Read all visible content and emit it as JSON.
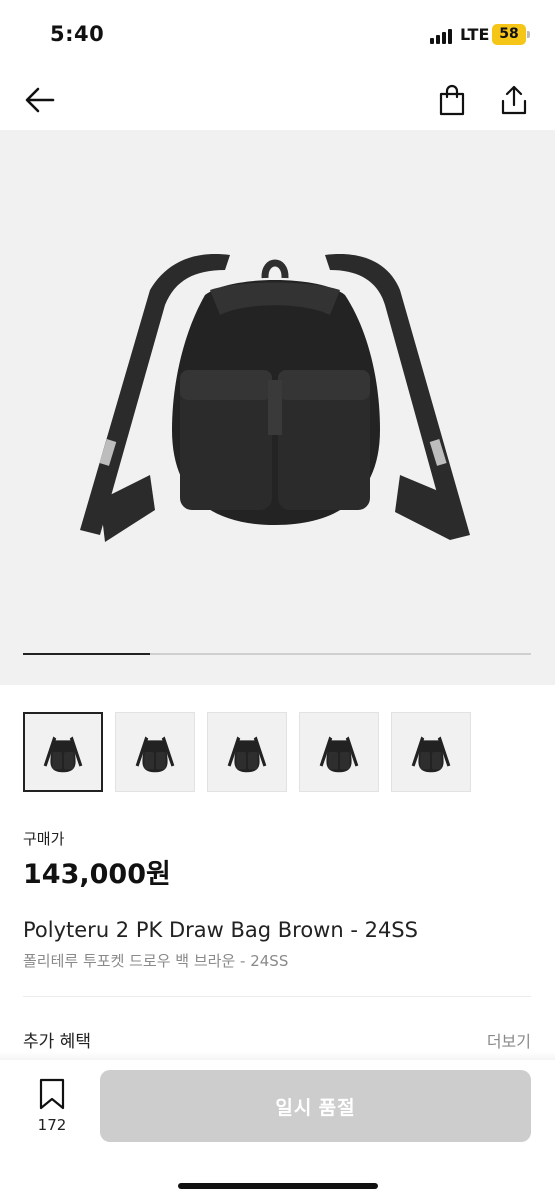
{
  "status_bar": {
    "time": "5:40",
    "network": "LTE",
    "battery": "58"
  },
  "nav": {
    "back_icon": "arrow-left-icon",
    "bag_icon": "shopping-bag-icon",
    "share_icon": "share-icon"
  },
  "hero": {
    "image": "black-drawstring-backpack",
    "gallery_progress": 0.25
  },
  "thumbnails": [
    {
      "name": "front-view",
      "active": true
    },
    {
      "name": "alt-front-view",
      "active": false
    },
    {
      "name": "angled-view",
      "active": false
    },
    {
      "name": "back-view",
      "active": false
    },
    {
      "name": "side-view",
      "active": false
    }
  ],
  "product": {
    "price_label": "구매가",
    "price": "143,000원",
    "name_en": "Polyteru 2 PK Draw Bag Brown - 24SS",
    "name_ko": "폴리테루 투포켓 드로우 백 브라운 - 24SS"
  },
  "benefits": {
    "title": "추가 혜택",
    "more": "더보기"
  },
  "bottom_bar": {
    "wish_count": "172",
    "cta_label": "일시 품절"
  },
  "colors": {
    "cta_disabled": "#cdcdcd",
    "battery": "#f5c518",
    "hero_bg": "#f1f1f1"
  }
}
